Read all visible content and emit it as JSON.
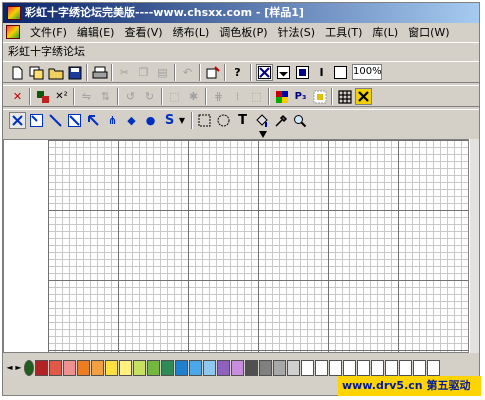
{
  "window": {
    "title": "彩虹十字绣论坛完美版----www.chsxx.com - [样品1]"
  },
  "menubar": {
    "items": [
      {
        "label": "文件(F)",
        "key": "file"
      },
      {
        "label": "编辑(E)",
        "key": "edit"
      },
      {
        "label": "查看(V)",
        "key": "view"
      },
      {
        "label": "绣布(L)",
        "key": "fabric"
      },
      {
        "label": "调色板(P)",
        "key": "palette"
      },
      {
        "label": "针法(S)",
        "key": "stitch"
      },
      {
        "label": "工具(T)",
        "key": "tools"
      },
      {
        "label": "库(L)",
        "key": "library"
      },
      {
        "label": "窗口(W)",
        "key": "window"
      }
    ]
  },
  "document": {
    "title": "彩虹十字绣论坛"
  },
  "toolbar": {
    "zoom_value": "100%",
    "text_tool_label": "T",
    "shape_tool_label": "S",
    "insert_tool_label": "I",
    "help_label": "?"
  },
  "palette": {
    "colors": [
      "#1e5f1e",
      "#b22323",
      "#e0584a",
      "#f09090",
      "#ee7c20",
      "#f4a040",
      "#ffe040",
      "#fff080",
      "#c8e060",
      "#70b840",
      "#2e8b57",
      "#2080d0",
      "#4aa8e8",
      "#8ec8f0",
      "#9060c0",
      "#c88ce0",
      "#505050",
      "#808080",
      "#a8a8a8",
      "#d0d0d0",
      "#ffffff",
      "#ffffff",
      "#ffffff",
      "#ffffff",
      "#ffffff",
      "#ffffff",
      "#ffffff",
      "#ffffff",
      "#ffffff",
      "#ffffff"
    ]
  },
  "watermark": {
    "text": "www.drv5.cn 第五驱动"
  }
}
